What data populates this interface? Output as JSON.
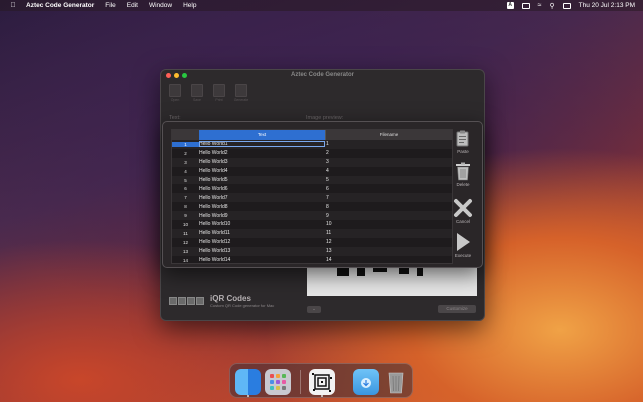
{
  "menubar": {
    "app_name": "Aztec Code Generator",
    "menus": [
      "File",
      "Edit",
      "Window",
      "Help"
    ],
    "clock": "Thu 20 Jul  2:13 PM"
  },
  "window": {
    "title": "Aztec Code Generator",
    "toolbar": [
      "Open",
      "Save",
      "Print",
      "Generate"
    ],
    "text_label": "Text:",
    "preview_label": "Image preview:",
    "logo_title": "iQR Codes",
    "logo_subtitle": "Custom QR Code generator for Mac",
    "customize_label": "Customize"
  },
  "sheet": {
    "columns": {
      "text": "Text",
      "filename": "Filename"
    },
    "rows": [
      {
        "num": "1",
        "text": "Hello World1",
        "file": "1"
      },
      {
        "num": "2",
        "text": "Hello World2",
        "file": "2"
      },
      {
        "num": "3",
        "text": "Hello World3",
        "file": "3"
      },
      {
        "num": "4",
        "text": "Hello World4",
        "file": "4"
      },
      {
        "num": "5",
        "text": "Hello World5",
        "file": "5"
      },
      {
        "num": "6",
        "text": "Hello World6",
        "file": "6"
      },
      {
        "num": "7",
        "text": "Hello World7",
        "file": "7"
      },
      {
        "num": "8",
        "text": "Hello World8",
        "file": "8"
      },
      {
        "num": "9",
        "text": "Hello World9",
        "file": "9"
      },
      {
        "num": "10",
        "text": "Hello World10",
        "file": "10"
      },
      {
        "num": "11",
        "text": "Hello World11",
        "file": "11"
      },
      {
        "num": "12",
        "text": "Hello World12",
        "file": "12"
      },
      {
        "num": "13",
        "text": "Hello World13",
        "file": "13"
      },
      {
        "num": "14",
        "text": "Hello World14",
        "file": "14"
      }
    ],
    "buttons": {
      "paste": "Paste",
      "delete": "Delete",
      "cancel": "Cancel",
      "execute": "Execute"
    }
  },
  "dock": {
    "items": [
      "finder-icon",
      "launchpad-icon",
      "aztec-code-generator-icon",
      "downloads-folder-icon",
      "trash-icon"
    ]
  },
  "colors": {
    "accent": "#2e6fd1",
    "window_bg": "#2d2a2c"
  }
}
